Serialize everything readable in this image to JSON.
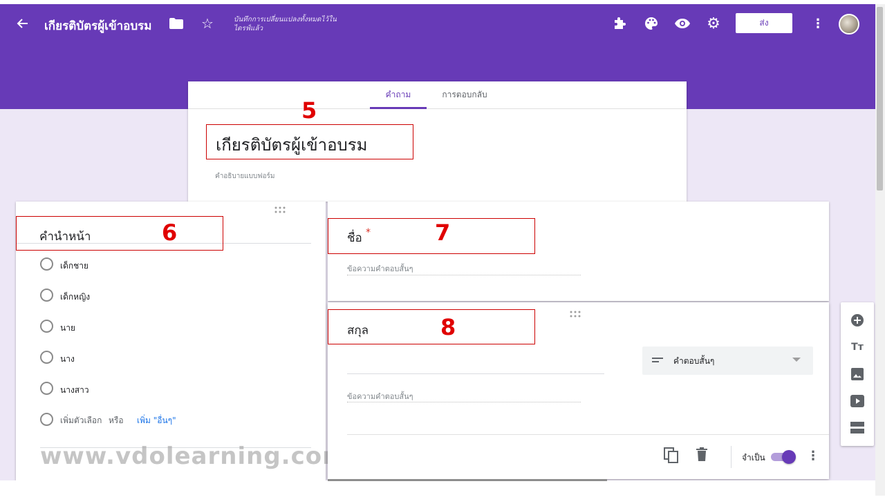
{
  "header": {
    "title": "เกียรติบัตรผู้เข้าอบรม",
    "save_status": "บันทึกการเปลี่ยนแปลงทั้งหมดไว้ในไดรฟ์แล้ว",
    "send_label": "ส่ง",
    "icons": [
      "back-arrow-icon",
      "folder-icon",
      "star-icon",
      "puzzle-icon",
      "palette-icon",
      "eye-icon",
      "gear-icon",
      "more-vert-icon",
      "avatar"
    ]
  },
  "tabs": [
    {
      "label": "คำถาม",
      "active": true
    },
    {
      "label": "การตอบกลับ",
      "active": false
    }
  ],
  "form": {
    "title": "เกียรติบัตรผู้เข้าอบรม",
    "description_placeholder": "คำอธิบายแบบฟอร์ม"
  },
  "annotations": {
    "n5": "5",
    "n6": "6",
    "n7": "7",
    "n8": "8"
  },
  "questions": [
    {
      "title": "คำนำหน้า",
      "options": [
        "เด็กชาย",
        "เด็กหญิง",
        "นาย",
        "นาง",
        "นางสาว"
      ],
      "add_option": "เพิ่มตัวเลือก",
      "or": "หรือ",
      "add_other": "เพิ่ม \"อื่นๆ\""
    },
    {
      "title": "ชื่อ",
      "required_mark": "*",
      "answer_placeholder": "ข้อความคำตอบสั้นๆ"
    },
    {
      "title": "สกุล",
      "answer_placeholder": "ข้อความคำตอบสั้นๆ",
      "type": "คำตอบสั้นๆ",
      "required_label": "จำเป็น",
      "required": true
    }
  ],
  "watermark": "www.vdolearning.com",
  "toolbar": [
    "add-question-icon",
    "title-text-icon",
    "image-icon",
    "video-icon",
    "section-icon"
  ],
  "colors": {
    "theme": "#673ab7",
    "background": "#ede7f6",
    "annotation": "#e00000",
    "link": "#1a73e8"
  }
}
